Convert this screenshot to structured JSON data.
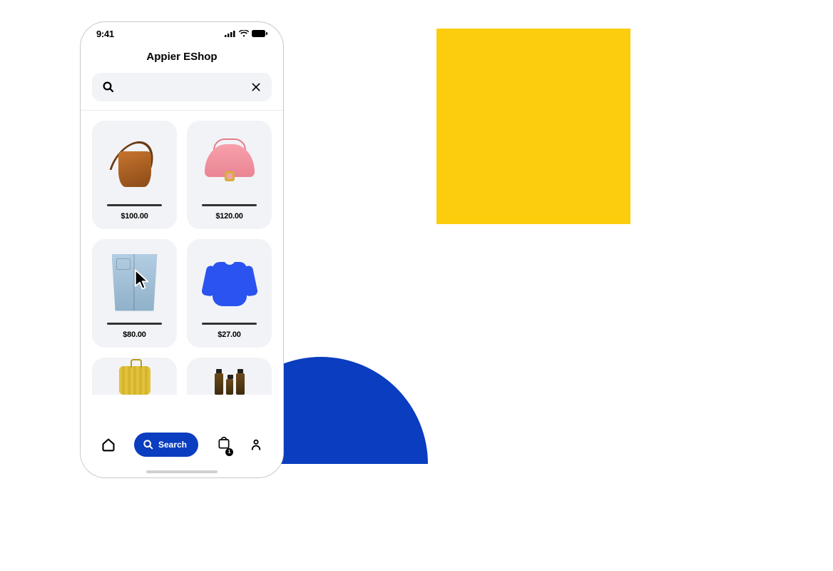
{
  "status": {
    "time": "9:41"
  },
  "shop": {
    "title": "Appier EShop"
  },
  "search": {
    "placeholder": ""
  },
  "products": [
    {
      "price": "$100.00",
      "item": "brown-shoulder-bag"
    },
    {
      "price": "$120.00",
      "item": "pink-saddle-bag"
    },
    {
      "price": "$80.00",
      "item": "light-denim-jeans"
    },
    {
      "price": "$27.00",
      "item": "blue-long-sleeve-shirt"
    },
    {
      "price": "",
      "item": "yellow-luggage"
    },
    {
      "price": "",
      "item": "dropper-bottles"
    }
  ],
  "nav": {
    "search_label": "Search",
    "cart_badge": "1"
  },
  "decor": {
    "yellow": "#FCCD0C",
    "blue": "#0A3DBF"
  }
}
